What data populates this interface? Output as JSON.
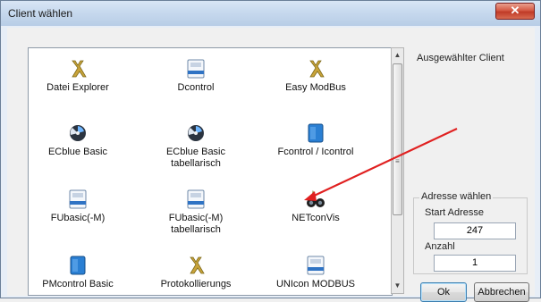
{
  "window": {
    "title": "Client wählen",
    "close_glyph": "✕"
  },
  "list": {
    "items": [
      {
        "label": "Datei Explorer",
        "icon": "tool-icon"
      },
      {
        "label": "Dcontrol",
        "icon": "device-panel-icon"
      },
      {
        "label": "Easy ModBus",
        "icon": "tool-icon"
      },
      {
        "label": "ECblue Basic",
        "icon": "fan-icon"
      },
      {
        "label": "ECblue Basic\ntabellarisch",
        "icon": "fan-icon"
      },
      {
        "label": "Fcontrol / Icontrol",
        "icon": "blue-box-icon"
      },
      {
        "label": "FUbasic(-M)",
        "icon": "device-panel-icon"
      },
      {
        "label": "FUbasic(-M)\ntabellarisch",
        "icon": "device-panel-icon"
      },
      {
        "label": "NETconVis",
        "icon": "binoculars-icon"
      },
      {
        "label": "PMcontrol Basic",
        "icon": "blue-box-icon"
      },
      {
        "label": "Protokollierungs",
        "icon": "tool-icon"
      },
      {
        "label": "UNIcon MODBUS",
        "icon": "device-panel-icon"
      }
    ],
    "scroll": {
      "up": "▲",
      "down": "▼",
      "grip": "≡"
    }
  },
  "right": {
    "selected_client_label": "Ausgewählter Client",
    "address_group_title": "Adresse wählen",
    "start_address_label": "Start Adresse",
    "start_address_value": "247",
    "count_label": "Anzahl",
    "count_value": "1",
    "ok_label": "Ok",
    "cancel_label": "Abbrechen"
  },
  "colors": {
    "arrow": "#e02020",
    "accent": "#3c7fb1"
  }
}
